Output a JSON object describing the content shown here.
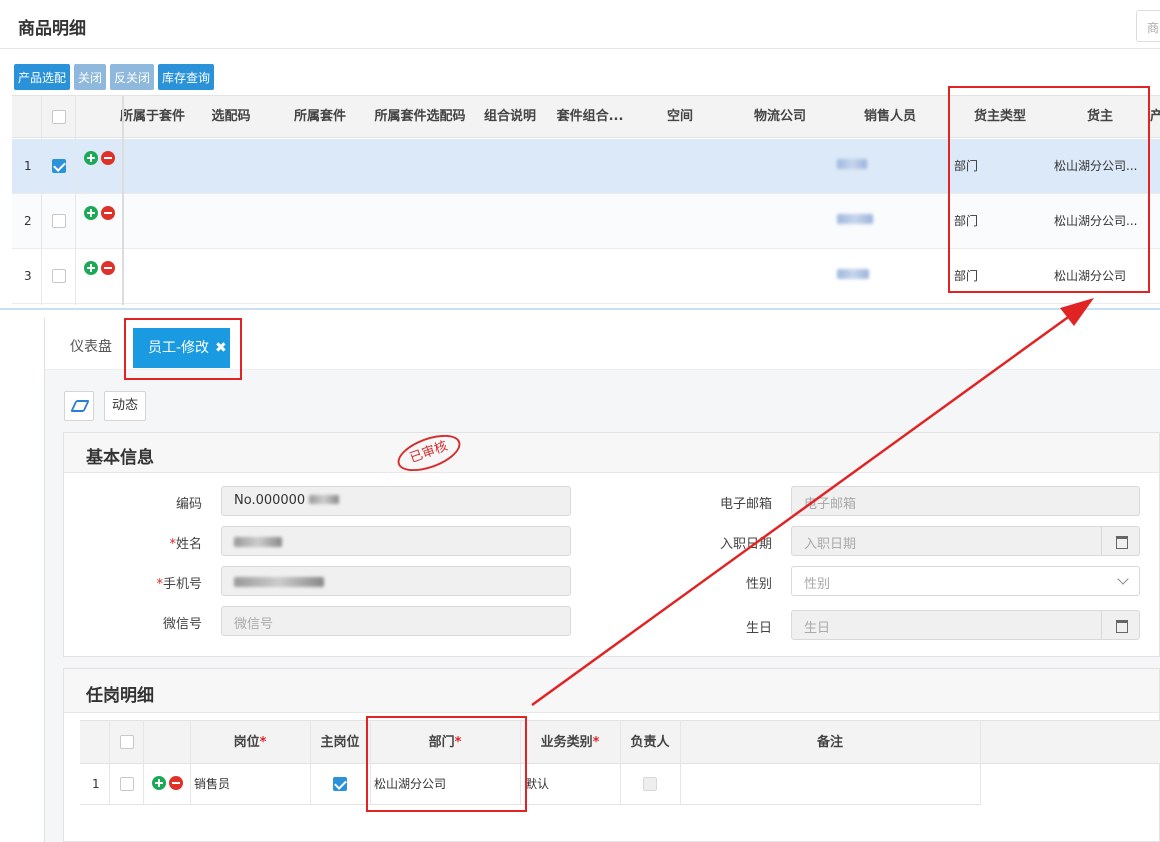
{
  "top": {
    "title": "商品明细",
    "search_placeholder": "商品",
    "toolbar": {
      "product_select": "产品选配",
      "close": "关闭",
      "reverse_close": "反关闭",
      "stock_query": "库存查询"
    },
    "columns": [
      "所属于套件",
      "选配码",
      "所属套件",
      "所属套件选配码",
      "组合说明",
      "套件组合...",
      "空间",
      "物流公司",
      "销售人员",
      "货主类型",
      "货主",
      "产"
    ],
    "rows": [
      {
        "no": "1",
        "checked": true,
        "owner_type": "部门",
        "owner": "松山湖分公司..."
      },
      {
        "no": "2",
        "checked": false,
        "owner_type": "部门",
        "owner": "松山湖分公司..."
      },
      {
        "no": "3",
        "checked": false,
        "owner_type": "部门",
        "owner": "松山湖分公司"
      }
    ]
  },
  "tabs": {
    "dashboard": "仪表盘",
    "edit": "员工-修改",
    "close_glyph": "✖"
  },
  "actions": {
    "dynamic": "动态"
  },
  "stamp": "已审核",
  "basic": {
    "title": "基本信息",
    "code_label": "编码",
    "code_value": "No.000000",
    "name_label": "姓名",
    "phone_label": "手机号",
    "wechat_label": "微信号",
    "wechat_placeholder": "微信号",
    "email_label": "电子邮箱",
    "email_placeholder": "电子邮箱",
    "join_label": "入职日期",
    "join_placeholder": "入职日期",
    "gender_label": "性别",
    "gender_placeholder": "性别",
    "birthday_label": "生日",
    "birthday_placeholder": "生日",
    "required_mark": "*"
  },
  "posts": {
    "title": "任岗明细",
    "columns": {
      "post": "岗位",
      "main_post": "主岗位",
      "dept": "部门",
      "biz_type": "业务类别",
      "leader": "负责人",
      "remark": "备注"
    },
    "row": {
      "no": "1",
      "post": "销售员",
      "dept": "松山湖分公司",
      "biz_type": "默认"
    }
  },
  "accent_colors": {
    "primary": "#2a92d8",
    "tab_active": "#1a9ae0",
    "annotation": "#e02424"
  }
}
